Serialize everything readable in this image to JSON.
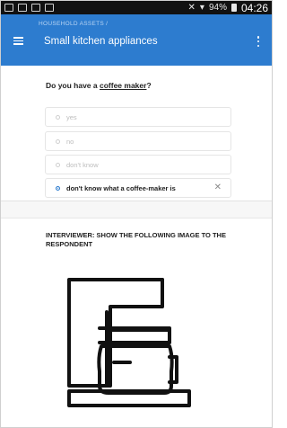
{
  "status": {
    "battery": "94%",
    "time": "04:26"
  },
  "appbar": {
    "breadcrumb": "HOUSEHOLD ASSETS /",
    "title": "Small kitchen appliances"
  },
  "question": {
    "prefix": "Do you have a ",
    "term": "coffee maker",
    "suffix": "?"
  },
  "options": [
    {
      "label": "yes",
      "selected": false
    },
    {
      "label": "no",
      "selected": false
    },
    {
      "label": "don't know",
      "selected": false
    },
    {
      "label": "don't know what a coffee-maker is",
      "selected": true
    }
  ],
  "instruction": "INTERVIEWER: SHOW THE FOLLOWING IMAGE TO THE RESPONDENT",
  "icons": {
    "menu": "menu-icon",
    "more": "more-vert-icon",
    "clear": "close-icon",
    "image": "coffee-maker-icon"
  },
  "colors": {
    "accent": "#2d7ccf",
    "statusbar": "#111111"
  }
}
